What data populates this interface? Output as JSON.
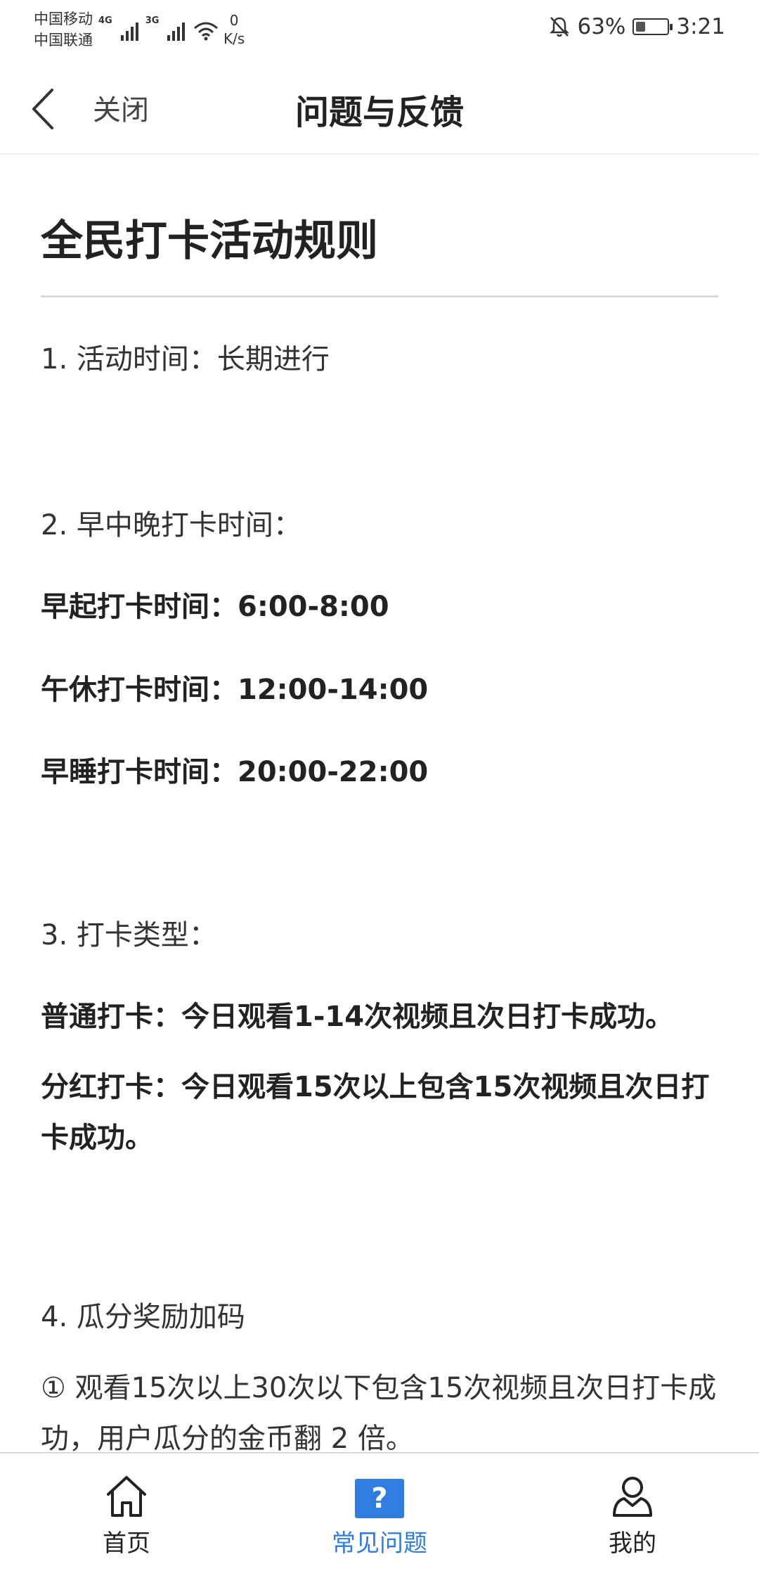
{
  "status_bar": {
    "carrier_1": "中国移动",
    "carrier_2": "中国联通",
    "network_1": "4G",
    "network_2": "3G",
    "speed_value": "0",
    "speed_unit": "K/s",
    "battery_percent": "63%",
    "time": "3:21",
    "battery_level": 0.63,
    "icons": [
      "signal-icon",
      "wifi-icon",
      "mute-bell-icon",
      "battery-icon"
    ]
  },
  "header": {
    "back_icon": "chevron-left-icon",
    "close_label": "关闭",
    "title": "问题与反馈"
  },
  "article": {
    "title": "全民打卡活动规则",
    "section_1": "1. 活动时间：长期进行",
    "section_2": "2. 早中晚打卡时间：",
    "morning": "早起打卡时间：6:00-8:00",
    "noon": "午休打卡时间：12:00-14:00",
    "evening": "早睡打卡时间：20:00-22:00",
    "section_3": "3.  打卡类型：",
    "normal_checkin": "普通打卡：今日观看1-14次视频且次日打卡成功。",
    "bonus_checkin": "分红打卡：今日观看15次以上包含15次视频且次日打卡成功。",
    "section_4": "4. 瓜分奖励加码",
    "reward_1": "① 观看15次以上30次以下包含15次视频且次日打卡成功，用户瓜分的金币翻 2 倍。"
  },
  "bottom_nav": {
    "items": [
      {
        "label": "首页",
        "icon": "home-icon",
        "active": false
      },
      {
        "label": "常见问题",
        "icon": "question-icon",
        "active": true
      },
      {
        "label": "我的",
        "icon": "person-icon",
        "active": false
      }
    ],
    "active_color": "#2f7de1"
  }
}
